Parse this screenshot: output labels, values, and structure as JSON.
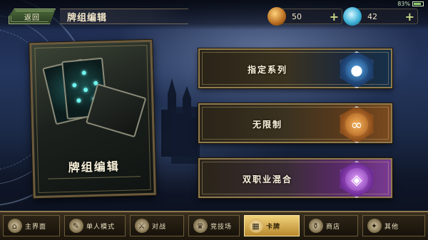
{
  "header": {
    "back_label": "返回",
    "title": "牌组编辑"
  },
  "resources": {
    "gold": {
      "value": "50",
      "plus": "+",
      "icon": "gold-coin-icon"
    },
    "gem": {
      "value": "42",
      "plus": "+",
      "icon": "crystal-icon"
    }
  },
  "status_bar": {
    "battery": "83%",
    "battery_level": 0.83
  },
  "deck_panel": {
    "label": "牌组编辑"
  },
  "options": [
    {
      "label": "指定系列",
      "emblem": "blue-orb-emblem",
      "color": "#3a78b8"
    },
    {
      "label": "无限制",
      "emblem": "infinity-emblem",
      "color": "#e09a48"
    },
    {
      "label": "双职业混合",
      "emblem": "dual-class-emblem",
      "color": "#c76ae8"
    }
  ],
  "nav": {
    "tabs": [
      {
        "label": "主界面",
        "icon": "home-icon",
        "active": false
      },
      {
        "label": "单人模式",
        "icon": "quill-icon",
        "active": false
      },
      {
        "label": "对战",
        "icon": "crossed-swords-icon",
        "active": false
      },
      {
        "label": "竞技场",
        "icon": "arena-icon",
        "active": false
      },
      {
        "label": "卡牌",
        "icon": "cards-icon",
        "active": true
      },
      {
        "label": "商店",
        "icon": "shop-icon",
        "active": false
      },
      {
        "label": "其他",
        "icon": "more-icon",
        "active": false
      }
    ]
  }
}
